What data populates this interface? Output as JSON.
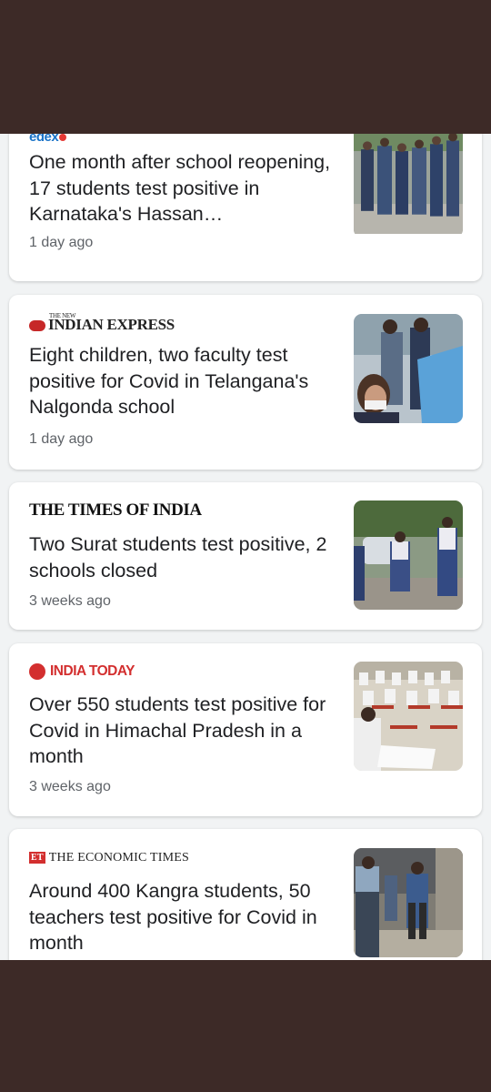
{
  "colors": {
    "background": "#3d2a27",
    "feed_background": "#f1f3f4",
    "card": "#ffffff",
    "headline": "#202124",
    "meta": "#5f6368"
  },
  "articles": [
    {
      "source": "edex",
      "logo_icon": "edex-logo-icon",
      "headline": "One month after school reopening, 17 students test positive in Karnataka's Hassan…",
      "time": "1 day ago",
      "image": "students-walking-image"
    },
    {
      "source": "THE NEW INDIAN EXPRESS",
      "source_small": "THE NEW",
      "source_main": "INDIAN EXPRESS",
      "logo_icon": "new-indian-express-logo-icon",
      "headline": "Eight children, two faculty test positive for Covid in Telangana's Nalgonda school",
      "time": "1 day ago",
      "image": "covid-swab-test-image"
    },
    {
      "source": "THE TIMES OF INDIA",
      "logo_icon": "times-of-india-logo-icon",
      "headline": "Two Surat students test positive, 2 schools closed",
      "time": "3 weeks ago",
      "image": "school-girls-street-image"
    },
    {
      "source": "INDIA TODAY",
      "logo_icon": "india-today-logo-icon",
      "headline": "Over 550 students test positive for Covid in Himachal Pradesh in a month",
      "time": "3 weeks ago",
      "image": "exam-hall-image"
    },
    {
      "source": "THE ECONOMIC TIMES",
      "source_mark": "ET",
      "logo_icon": "economic-times-logo-icon",
      "headline": "Around 400 Kangra students, 50 teachers test positive for Covid in month",
      "time": "",
      "image": "school-corridor-image"
    }
  ]
}
